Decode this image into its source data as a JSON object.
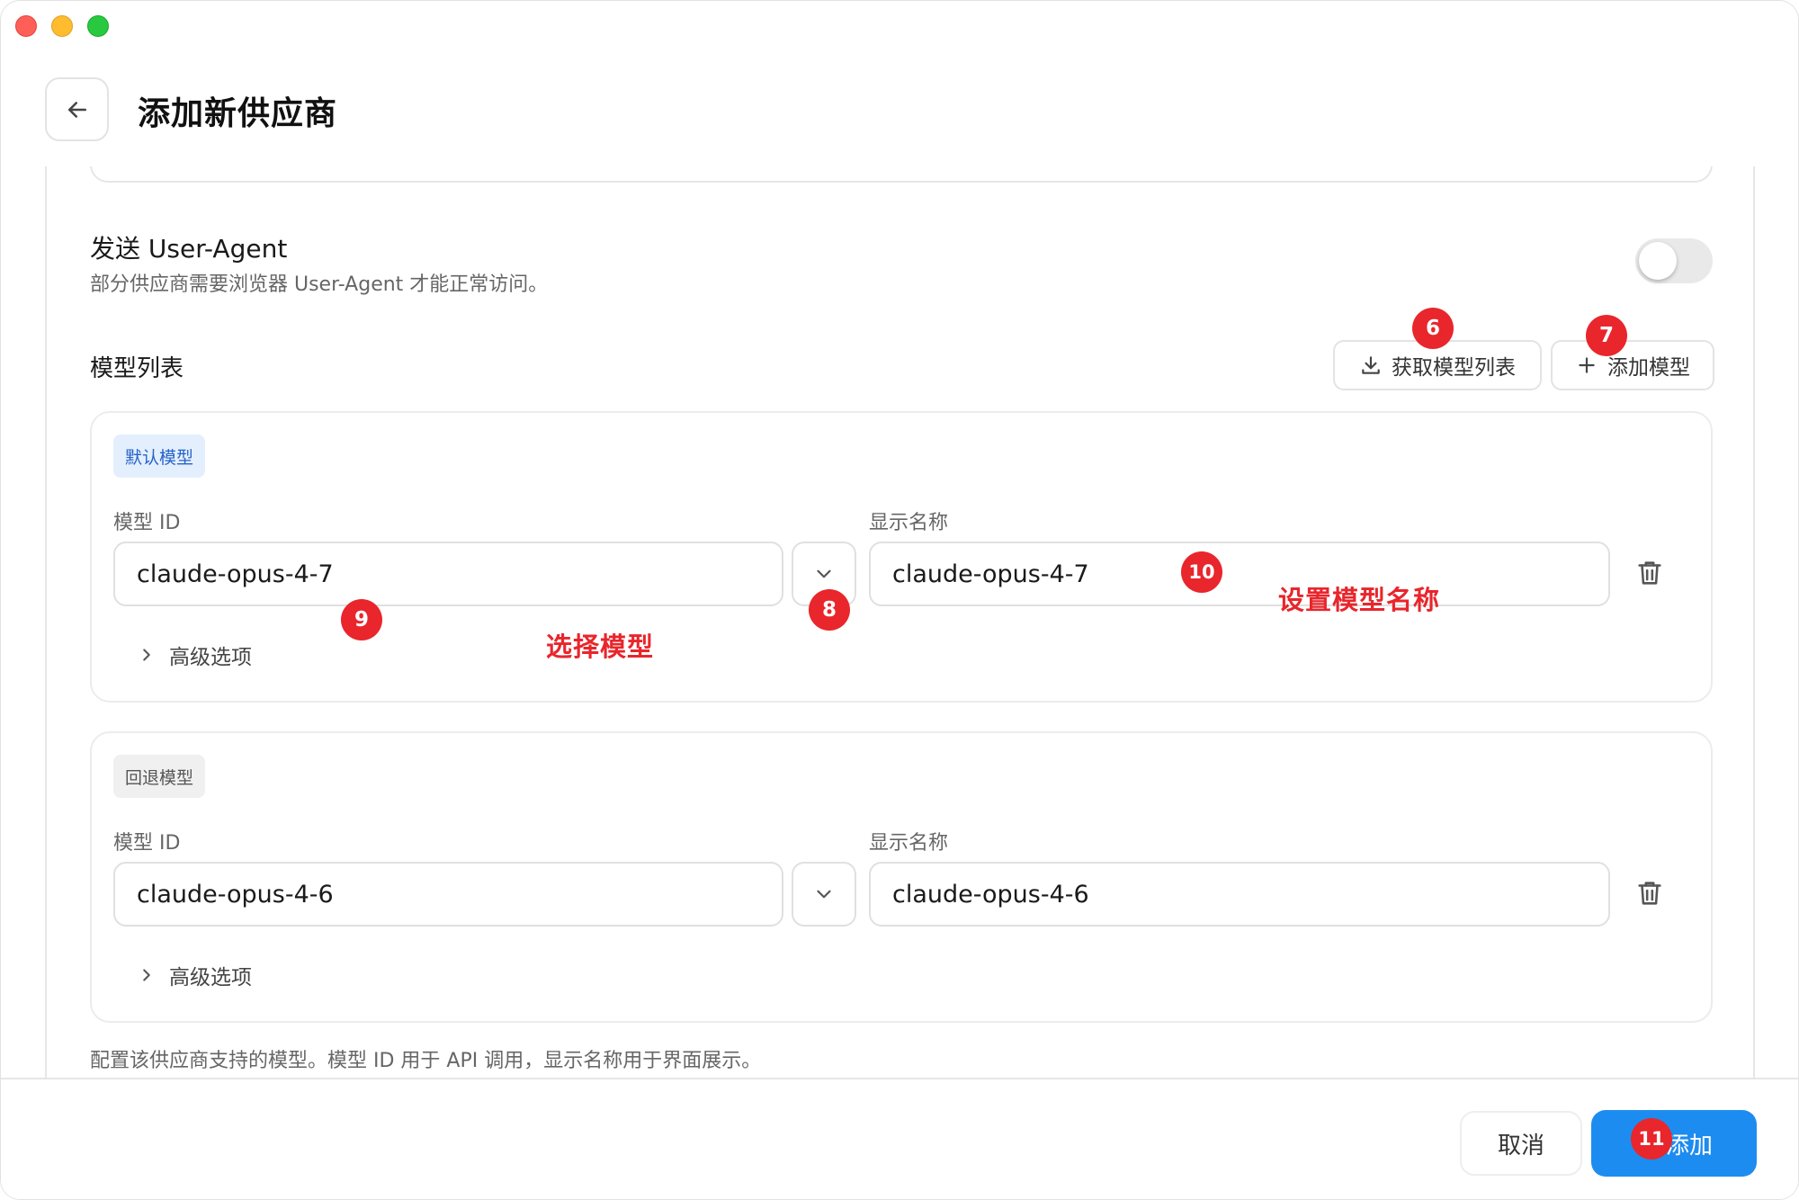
{
  "header": {
    "title": "添加新供应商"
  },
  "user_agent": {
    "title": "发送 User-Agent",
    "description": "部分供应商需要浏览器 User-Agent 才能正常访问。",
    "enabled": false
  },
  "model_list": {
    "title": "模型列表",
    "fetch_label": "获取模型列表",
    "add_label": "添加模型",
    "models": [
      {
        "tag": "默认模型",
        "id_label": "模型 ID",
        "id_value": "claude-opus-4-7",
        "name_label": "显示名称",
        "name_value": "claude-opus-4-7",
        "advanced_label": "高级选项"
      },
      {
        "tag": "回退模型",
        "id_label": "模型 ID",
        "id_value": "claude-opus-4-6",
        "name_label": "显示名称",
        "name_value": "claude-opus-4-6",
        "advanced_label": "高级选项"
      }
    ],
    "footnote": "配置该供应商支持的模型。模型 ID 用于 API 调用，显示名称用于界面展示。"
  },
  "footer": {
    "cancel_label": "取消",
    "submit_label": "添加"
  },
  "annotations": {
    "badges": [
      "6",
      "7",
      "8",
      "9",
      "10",
      "11"
    ],
    "select_model_note": "选择模型",
    "set_name_note": "设置模型名称"
  },
  "colors": {
    "accent": "#1d8cf0",
    "annotation": "#e8262c",
    "tag_default_bg": "#e4effd",
    "tag_default_text": "#2563c9"
  }
}
